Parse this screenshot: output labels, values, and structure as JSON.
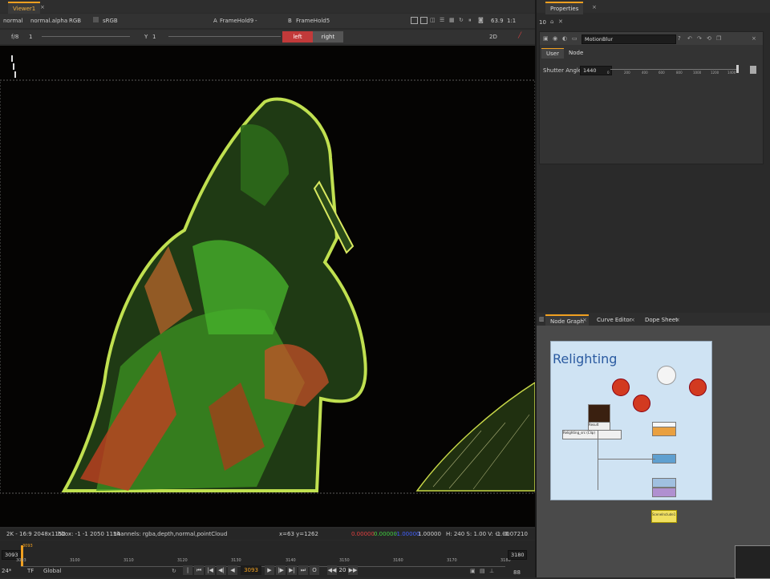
{
  "viewer": {
    "tab_label": "Viewer1",
    "colorspace_mode": "normal",
    "alpha_mode": "normal.alpha",
    "channels": "RGB",
    "lut": "sRGB",
    "input_a_label": "A",
    "input_a_value": "FrameHold9",
    "input_a_op": "-",
    "input_b_label": "B",
    "input_b_value": "FrameHold5",
    "zoom": "63.9",
    "ratio": "1:1",
    "fstop": "f/8",
    "gain_value": "1",
    "gamma_label": "Y",
    "gamma_value": "1",
    "left_label": "left",
    "right_label": "right",
    "view_mode": "2D",
    "status_format": "2K - 16:9 2048x1152",
    "status_bbox": "bbox: -1 -1 2050 1154",
    "status_channels": "channels: rgba,depth,normal,pointCloud",
    "status_coords": "x=63 y=1262",
    "pixel_r": "0.00000",
    "pixel_g": "0.00000",
    "pixel_b": "-1.00000",
    "pixel_a": "1.00000",
    "pixel_hsv": "H: 240 S: 1.00 V: -1.00",
    "pixel_l": "L: -0.07210"
  },
  "timeline": {
    "start_frame": "3093",
    "end_frame": "3180",
    "current_frame": "3093",
    "cur_marker": "3093",
    "ticks": [
      "3093",
      "3100",
      "3110",
      "3120",
      "3130",
      "3140",
      "3150",
      "3160",
      "3170",
      "3180"
    ],
    "fps": "24*",
    "tf_mode": "TF",
    "range_mode": "Global",
    "step": "20",
    "playback_count": "88"
  },
  "properties": {
    "tab_label": "Properties",
    "max_panels": "10",
    "node_name": "MotionBlur",
    "tabs": [
      "User",
      "Node"
    ],
    "shutter_label": "Shutter Angle",
    "shutter_value": "1440",
    "slider_ticks": [
      "0",
      "200",
      "400",
      "600",
      "800",
      "1000",
      "1200",
      "1400"
    ]
  },
  "node_graph": {
    "tabs": [
      "Node Graph",
      "Curve Editor",
      "Dope Sheet"
    ],
    "backdrop_title": "Relighting",
    "node_label_1": "Result",
    "node_label_2": "Relighting_src (Clip)",
    "bottom_node": "SceneInclude1"
  },
  "colors": {
    "accent": "#f0a020",
    "panel_bg": "#2a2a2a",
    "left_btn": "#c23a3a",
    "pixel_red": "#e04040",
    "pixel_green": "#40d040",
    "pixel_blue": "#4060ff",
    "backdrop_bg": "#cfe3f3"
  }
}
